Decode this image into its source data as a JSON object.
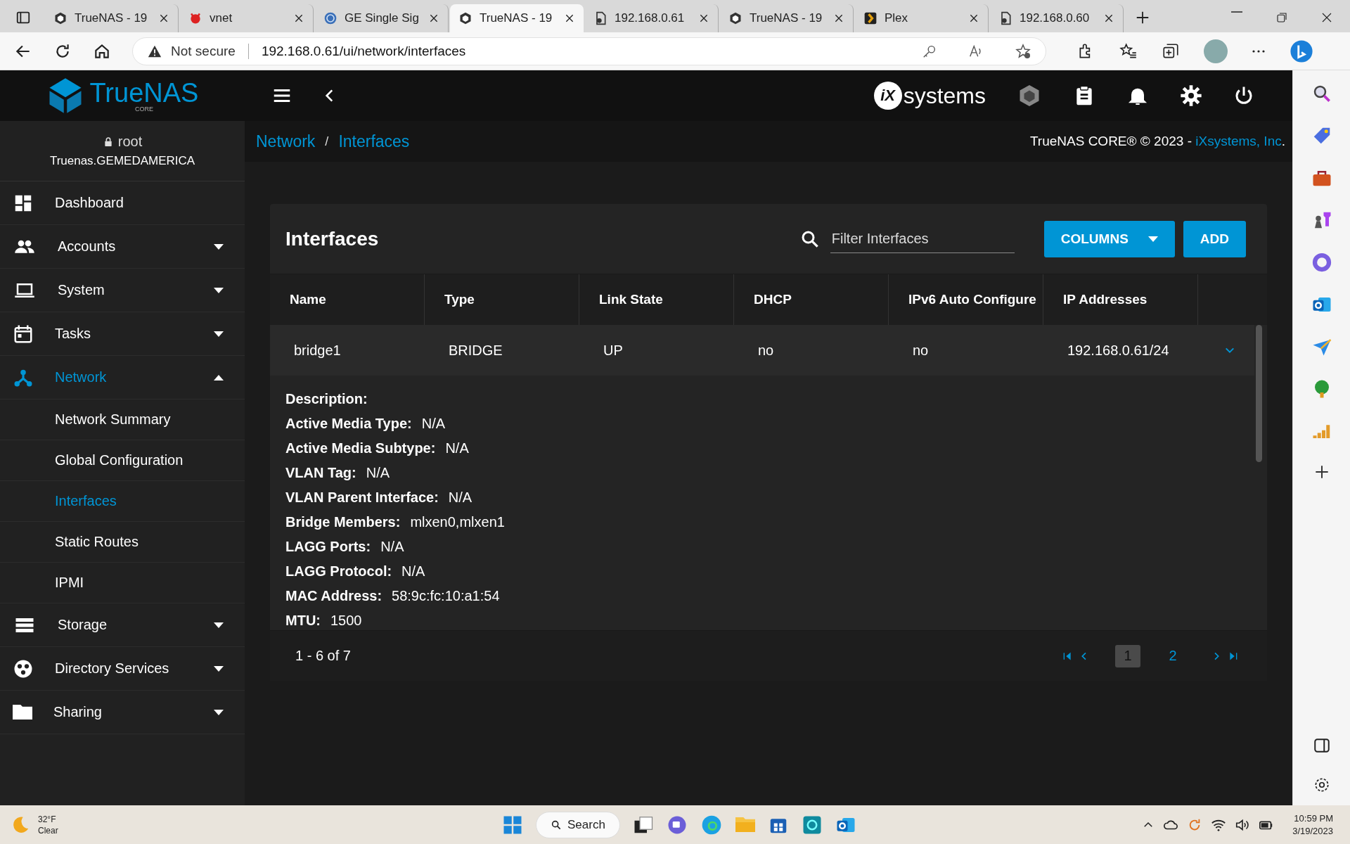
{
  "browser": {
    "tabs": [
      {
        "title": "TrueNAS - 19",
        "kind": "truenas",
        "selected": false
      },
      {
        "title": "vnet",
        "kind": "devil",
        "selected": false
      },
      {
        "title": "GE Single Sig",
        "kind": "globe",
        "selected": false
      },
      {
        "title": "TrueNAS - 19",
        "kind": "truenas",
        "selected": true
      },
      {
        "title": "192.168.0.61",
        "kind": "page",
        "selected": false
      },
      {
        "title": "TrueNAS - 19",
        "kind": "truenas",
        "selected": false
      },
      {
        "title": "Plex",
        "kind": "plex",
        "selected": false
      },
      {
        "title": "192.168.0.60",
        "kind": "page",
        "selected": false
      }
    ],
    "address": {
      "warning": "Not secure",
      "url": "192.168.0.61/ui/network/interfaces"
    }
  },
  "header": {
    "logo": "TrueNAS",
    "logo_sub": "CORE",
    "brand_mark": "iX",
    "brand_word": "systems"
  },
  "user": {
    "name": "root",
    "host": "Truenas.GEMEDAMERICA"
  },
  "nav": [
    {
      "label": "Dashboard",
      "kind": "dashboard",
      "selected": false
    },
    {
      "label": "Accounts",
      "kind": "accounts",
      "selected": false,
      "expanded": false
    },
    {
      "label": "System",
      "kind": "laptop",
      "selected": false,
      "expanded": false
    },
    {
      "label": "Tasks",
      "kind": "calendar",
      "selected": false,
      "expanded": false
    },
    {
      "label": "Network",
      "kind": "network",
      "selected": true,
      "expanded": true,
      "children": [
        {
          "label": "Network Summary",
          "selected": false
        },
        {
          "label": "Global Configuration",
          "selected": false
        },
        {
          "label": "Interfaces",
          "selected": true
        },
        {
          "label": "Static Routes",
          "selected": false
        },
        {
          "label": "IPMI",
          "selected": false
        }
      ]
    },
    {
      "label": "Storage",
      "kind": "storage",
      "selected": false,
      "expanded": false
    },
    {
      "label": "Directory Services",
      "kind": "directory",
      "selected": false,
      "expanded": false
    },
    {
      "label": "Sharing",
      "kind": "folder",
      "selected": false,
      "expanded": false
    }
  ],
  "breadcrumb": {
    "links": [
      "Network",
      "Interfaces"
    ],
    "separator": "/"
  },
  "copyright": {
    "text": "TrueNAS CORE® © 2023 - ",
    "link": "iXsystems, Inc",
    "end": "."
  },
  "card": {
    "title": "Interfaces",
    "filter_placeholder": "Filter Interfaces",
    "buttons": [
      "COLUMNS",
      "ADD"
    ],
    "columns": [
      "Name",
      "Type",
      "Link State",
      "DHCP",
      "IPv6 Auto Configure",
      "IP Addresses"
    ],
    "rows": [
      {
        "cells": [
          "bridge1",
          "BRIDGE",
          "UP",
          "no",
          "no",
          "192.168.0.61/24"
        ],
        "expanded": true
      }
    ],
    "details": [
      {
        "label": "Description:"
      },
      {
        "label": "Active Media Type:",
        "value": "N/A"
      },
      {
        "label": "Active Media Subtype:",
        "value": "N/A"
      },
      {
        "label": "VLAN Tag:",
        "value": "N/A"
      },
      {
        "label": "VLAN Parent Interface:",
        "value": "N/A"
      },
      {
        "label": "Bridge Members:",
        "value": "mlxen0,mlxen1"
      },
      {
        "label": "LAGG Ports:",
        "value": "N/A"
      },
      {
        "label": "LAGG Protocol:",
        "value": "N/A"
      },
      {
        "label": "MAC Address:",
        "value": "58:9c:fc:10:a1:54"
      },
      {
        "label": "MTU:",
        "value": "1500"
      }
    ],
    "range": "1 - 6 of 7",
    "pages": [
      {
        "label": "1",
        "selected": true
      },
      {
        "label": "2",
        "selected": false
      }
    ]
  },
  "taskbar": {
    "temp": "32°F",
    "weather": "Clear",
    "search": "Search",
    "time": "10:59 PM",
    "date": "3/19/2023"
  }
}
